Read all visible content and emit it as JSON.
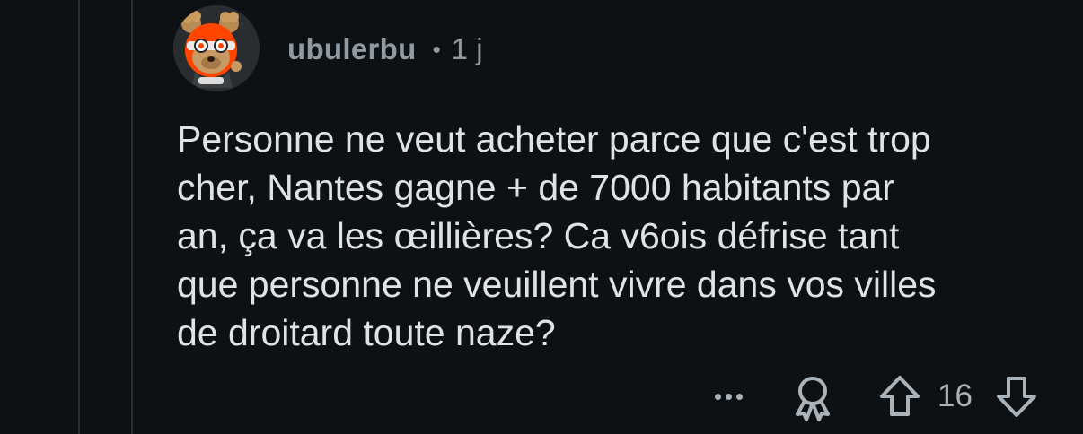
{
  "comment": {
    "author": {
      "username": "ubulerbu",
      "avatar_icon": "snoo-avatar-icon"
    },
    "separator": "•",
    "age": "1 j",
    "body_lines": [
      "Personne ne veut acheter parce que c'est trop",
      "cher, Nantes gagne + de 7000 habitants par",
      "an, ça va les œillières? Ca v6ois défrise tant",
      "que personne ne veuillent vivre dans vos villes",
      "de droitard toute naze?"
    ],
    "actions": {
      "more_icon": "ellipsis-icon",
      "award_icon": "award-icon",
      "upvote_icon": "upvote-arrow-icon",
      "score": "16",
      "downvote_icon": "downvote-arrow-icon"
    }
  },
  "colors": {
    "background": "#0e1113",
    "thread_line": "#2b3033",
    "meta_text": "#8f9aa3",
    "body_text": "#dfe3e6",
    "action_icon": "#aab3ba",
    "avatar_accent": "#ff4500"
  }
}
